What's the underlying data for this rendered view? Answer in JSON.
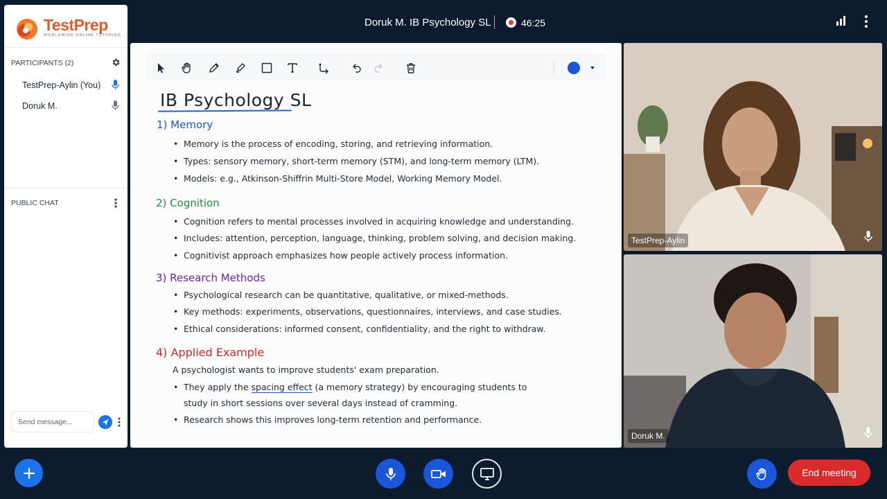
{
  "header": {
    "meeting_title": "Doruk M. IB Psychology SL",
    "timer": "46:25",
    "icons": [
      "signal-bars-icon",
      "more-vertical-icon"
    ]
  },
  "sidebar": {
    "brand": "TestPrep",
    "brand_tagline": "WORLDWIDE ONLINE TUTORING",
    "participants_header": "PARTICIPANTS (2)",
    "participants": [
      {
        "name": "TestPrep-Aylin (You)",
        "mic_active": true
      },
      {
        "name": "Doruk M.",
        "mic_active": false
      }
    ],
    "chat_header": "PUBLIC CHAT",
    "chat_placeholder": "Send message..."
  },
  "whiteboard": {
    "toolbar_tools": [
      "select-tool",
      "hand-tool",
      "pen-tool",
      "highlighter-tool",
      "rectangle-tool",
      "text-tool",
      "connector-tool",
      "undo",
      "redo",
      "delete"
    ],
    "selected_color": "#1a56db",
    "title": "IB Psychology SL",
    "sections": [
      {
        "heading": "1) Memory",
        "color": "#1a56db",
        "bullets": [
          "Memory is the process of encoding, storing, and retrieving information.",
          "Types: sensory memory, short-term memory (STM), and long-term memory (LTM).",
          "Models: e.g., Atkinson-Shiffrin Multi-Store Model, Working Memory Model."
        ]
      },
      {
        "heading": "2) Cognition",
        "color": "#1f8b3b",
        "bullets": [
          "Cognition refers to mental processes involved in acquiring knowledge and understanding.",
          "Includes: attention, perception, language, thinking, problem solving, and decision making.",
          "Cognitivist approach emphasizes how people actively process information."
        ]
      },
      {
        "heading": "3) Research Methods",
        "color": "#6b21a8",
        "bullets": [
          "Psychological research can be quantitative, qualitative, or mixed-methods.",
          "Key methods: experiments, observations, questionnaires, interviews, and case studies.",
          "Ethical considerations: informed consent, confidentiality, and the right to withdraw."
        ]
      },
      {
        "heading": "4) Applied Example",
        "color": "#dc2626",
        "intro": "A psychologist wants to improve students' exam preparation.",
        "b1_pre": "They apply the",
        "b1_link": "spacing effect",
        "b1_post": "(a memory strategy) by encouraging students to",
        "b1_cont": "study in short sessions over several days instead of cramming.",
        "b2": "Research shows this improves long-term retention and performance."
      }
    ]
  },
  "videos": [
    {
      "name": "TestPrep-Aylin"
    },
    {
      "name": "Doruk M."
    }
  ],
  "controls": {
    "end_meeting_label": "End meeting"
  }
}
